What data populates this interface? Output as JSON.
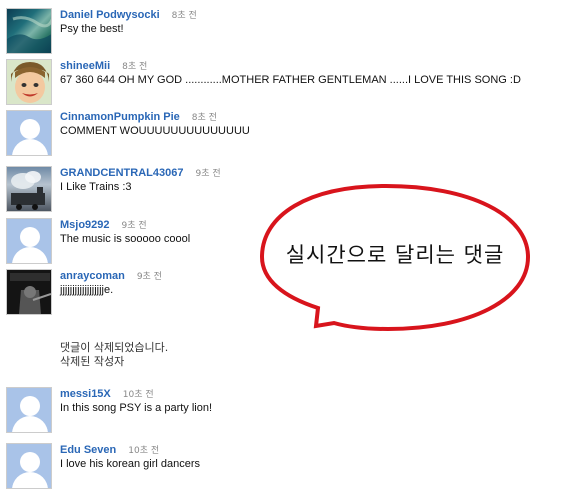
{
  "comments": [
    {
      "user": "Daniel Podwysocki",
      "time": "8초 전",
      "text": "Psy the best!",
      "avatar": "aerial-landscape"
    },
    {
      "user": "shineeMii",
      "time": "8초 전",
      "text": "67 360 644 OH MY GOD ............MOTHER FATHER GENTLEMAN ......I LOVE THIS SONG :D",
      "avatar": "cartoon-face"
    },
    {
      "user": "CinnamonPumpkin Pie",
      "time": "8초 전",
      "text": "COMMENT WOUUUUUUUUUUUUUU",
      "avatar": "default-person"
    },
    {
      "user": "GRANDCENTRAL43067",
      "time": "9초 전",
      "text": "I Like Trains :3",
      "avatar": "train-smoke"
    },
    {
      "user": "Msjo9292",
      "time": "9초 전",
      "text": "The music is sooooo coool",
      "avatar": "default-person"
    },
    {
      "user": "anraycoman",
      "time": "9초 전",
      "text": "jjjjjjjjjjjjjjjjjje.",
      "avatar": "call-of-duty"
    },
    {
      "user": "messi15X",
      "time": "10초 전",
      "text": "In this song PSY is a party lion!",
      "avatar": "default-person"
    },
    {
      "user": "Edu Seven",
      "time": "10초 전",
      "text": "I love his korean girl dancers",
      "avatar": "default-person"
    }
  ],
  "deleted": {
    "line1": "댓글이 삭제되었습니다.",
    "line2": "삭제된 작성자"
  },
  "callout": {
    "text": "실시간으로 달리는 댓글",
    "stroke": "#d8141c"
  },
  "colors": {
    "username": "#2a67b6",
    "avatar_bg": "#a9c3e8"
  }
}
